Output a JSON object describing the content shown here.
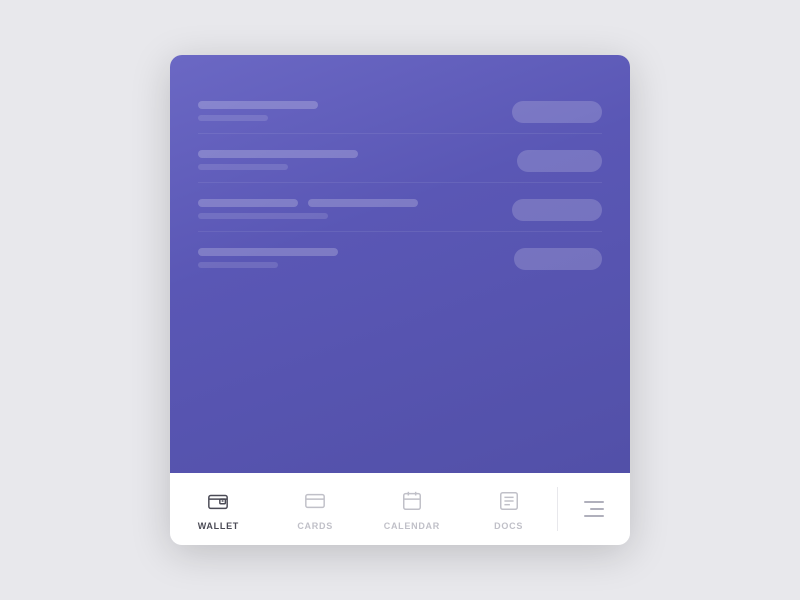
{
  "nav": {
    "tabs": [
      {
        "id": "wallet",
        "label": "WALLET",
        "active": true
      },
      {
        "id": "cards",
        "label": "CARDS",
        "active": false
      },
      {
        "id": "calendar",
        "label": "CALENDAR",
        "active": false
      },
      {
        "id": "docs",
        "label": "DOCS",
        "active": false
      }
    ]
  },
  "list_items": [
    {
      "id": 1
    },
    {
      "id": 2
    },
    {
      "id": 3
    },
    {
      "id": 4
    }
  ]
}
